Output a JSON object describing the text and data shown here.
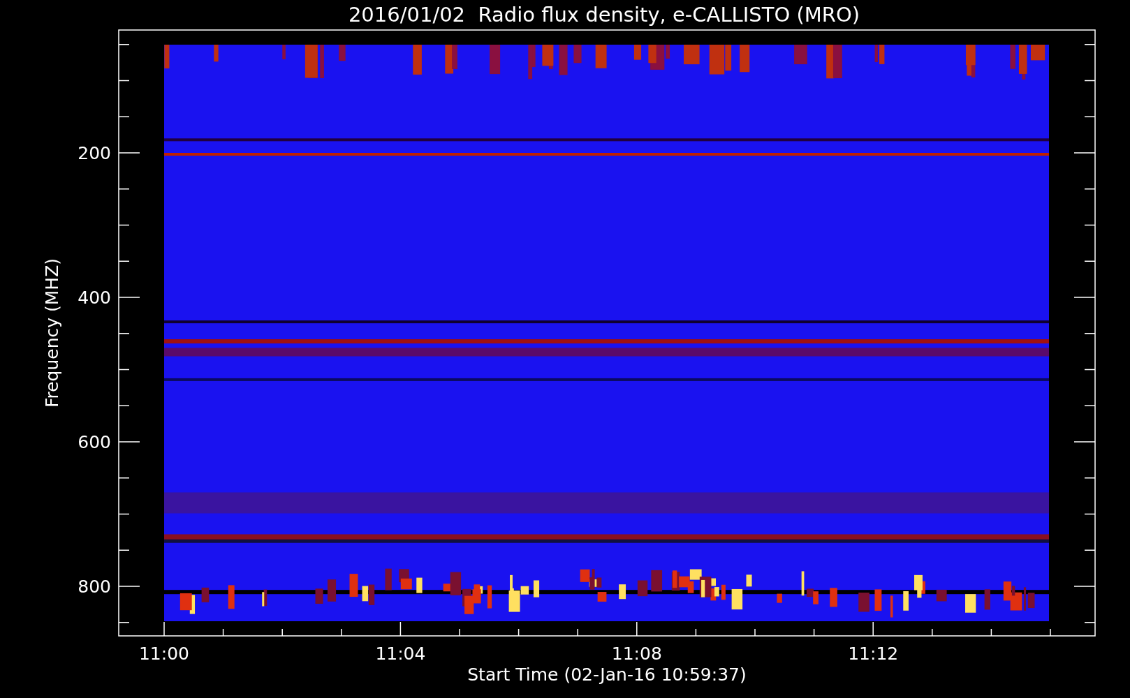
{
  "title": "2016/01/02  Radio flux density, e-CALLISTO (MRO)",
  "ylabel": "Frequency (MHZ)",
  "xlabel": "Start Time (02-Jan-16 10:59:37)",
  "yticks": [
    "200",
    "400",
    "600",
    "800"
  ],
  "xticks": [
    "11:00",
    "11:04",
    "11:08",
    "11:12"
  ]
}
